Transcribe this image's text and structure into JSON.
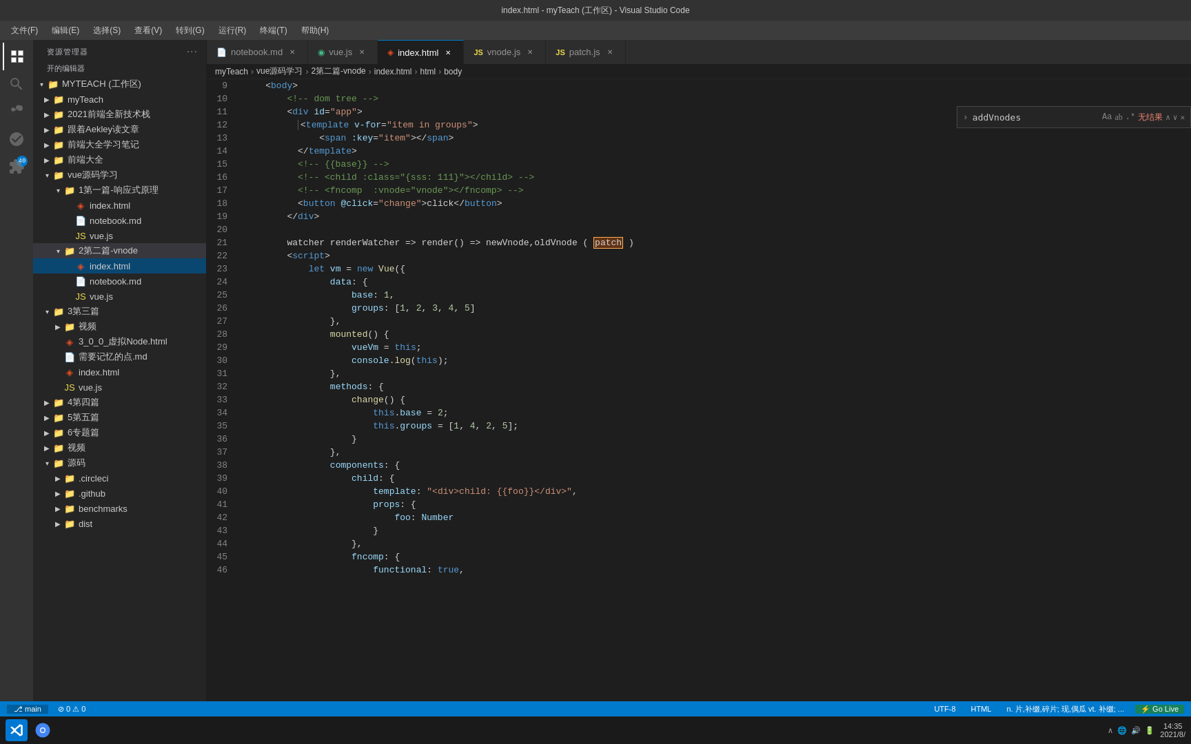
{
  "titleBar": {
    "text": "index.html - myTeach (工作区) - Visual Studio Code"
  },
  "menuBar": {
    "items": [
      "文件(F)",
      "编辑(E)",
      "选择(S)",
      "查看(V)",
      "转到(G)",
      "运行(R)",
      "终端(T)",
      "帮助(H)"
    ]
  },
  "sidebar": {
    "explorerTitle": "资源管理器",
    "openEditorTitle": "开的编辑器",
    "dots": "···",
    "tree": {
      "rootLabel": "MYTEACH (工作区)",
      "items": [
        {
          "id": "myTeach",
          "label": "myTeach",
          "type": "folder",
          "depth": 0,
          "expanded": false
        },
        {
          "id": "2021新技术栈",
          "label": "2021前端全新技术栈",
          "type": "folder",
          "depth": 0,
          "expanded": false
        },
        {
          "id": "Aekley笔记",
          "label": "跟着Aekley读文章",
          "type": "folder",
          "depth": 0,
          "expanded": false
        },
        {
          "id": "前端大学",
          "label": "前端大全学习笔记",
          "type": "folder",
          "depth": 0,
          "expanded": false
        },
        {
          "id": "前端大全",
          "label": "前端大全",
          "type": "folder",
          "depth": 0,
          "expanded": false
        },
        {
          "id": "vue源码学习",
          "label": "vue源码学习",
          "type": "folder",
          "depth": 0,
          "expanded": true
        },
        {
          "id": "1第一篇",
          "label": "1第一篇-响应式原理",
          "type": "folder",
          "depth": 1,
          "expanded": true
        },
        {
          "id": "index.html-1",
          "label": "index.html",
          "type": "html",
          "depth": 2,
          "expanded": false
        },
        {
          "id": "notebook.md-1",
          "label": "notebook.md",
          "type": "md",
          "depth": 2,
          "expanded": false
        },
        {
          "id": "vue.js-1",
          "label": "vue.js",
          "type": "js",
          "depth": 2,
          "expanded": false
        },
        {
          "id": "2第二篇-vnode",
          "label": "2第二篇-vnode",
          "type": "folder",
          "depth": 1,
          "expanded": true,
          "active": true
        },
        {
          "id": "index.html-2",
          "label": "index.html",
          "type": "html",
          "depth": 2,
          "expanded": false,
          "active": true
        },
        {
          "id": "notebook.md-2",
          "label": "notebook.md",
          "type": "md",
          "depth": 2,
          "expanded": false
        },
        {
          "id": "vue.js-2",
          "label": "vue.js",
          "type": "js",
          "depth": 2,
          "expanded": false
        },
        {
          "id": "3第三篇",
          "label": "3第三篇",
          "type": "folder",
          "depth": 0,
          "expanded": false
        },
        {
          "id": "视频1",
          "label": "视频",
          "type": "folder",
          "depth": 1,
          "expanded": false
        },
        {
          "id": "3_0_0",
          "label": "3_0_0_虚拟Node.html",
          "type": "html",
          "depth": 1,
          "expanded": false
        },
        {
          "id": "需要记忆",
          "label": "需要记忆的点.md",
          "type": "md",
          "depth": 1,
          "expanded": false
        },
        {
          "id": "index.html-3",
          "label": "index.html",
          "type": "html",
          "depth": 1,
          "expanded": false
        },
        {
          "id": "vue.js-3",
          "label": "vue.js",
          "type": "js",
          "depth": 1,
          "expanded": false
        },
        {
          "id": "4第四篇",
          "label": "4第四篇",
          "type": "folder",
          "depth": 0,
          "expanded": false
        },
        {
          "id": "5第五篇",
          "label": "5第五篇",
          "type": "folder",
          "depth": 0,
          "expanded": false
        },
        {
          "id": "6专题篇",
          "label": "6专题篇",
          "type": "folder",
          "depth": 0,
          "expanded": false
        },
        {
          "id": "视频2",
          "label": "视频",
          "type": "folder",
          "depth": 0,
          "expanded": false
        },
        {
          "id": "源码",
          "label": "源码",
          "type": "folder",
          "depth": 0,
          "expanded": true
        },
        {
          "id": "circleci",
          "label": ".circleci",
          "type": "folder",
          "depth": 1,
          "expanded": false
        },
        {
          "id": "github",
          "label": ".github",
          "type": "folder",
          "depth": 1,
          "expanded": false
        },
        {
          "id": "benchmarks",
          "label": "benchmarks",
          "type": "folder",
          "depth": 1,
          "expanded": false
        },
        {
          "id": "dist",
          "label": "dist",
          "type": "folder",
          "depth": 1,
          "expanded": false
        }
      ]
    }
  },
  "tabs": [
    {
      "id": "notebook",
      "label": "notebook.md",
      "icon": "md",
      "active": false,
      "closable": true
    },
    {
      "id": "vue",
      "label": "vue.js",
      "icon": "js",
      "active": false,
      "closable": true
    },
    {
      "id": "index",
      "label": "index.html",
      "icon": "html",
      "active": true,
      "closable": true
    },
    {
      "id": "vnode",
      "label": "vnode.js",
      "icon": "js",
      "active": false,
      "closable": true
    },
    {
      "id": "patch",
      "label": "patch.js",
      "icon": "js",
      "active": false,
      "closable": true
    }
  ],
  "breadcrumb": {
    "items": [
      "myTeach",
      "vue源码学习",
      "2第二篇-vnode",
      "index.html",
      "html",
      "body"
    ]
  },
  "searchBar": {
    "value": "addVnodes",
    "noResults": "无结果"
  },
  "codeLines": [
    {
      "num": 9,
      "content": "    <body>"
    },
    {
      "num": 10,
      "content": "        <!-- dom tree -->"
    },
    {
      "num": 11,
      "content": "        <div id=\"app\">"
    },
    {
      "num": 12,
      "content": "          <template v-for=\"item in groups\">"
    },
    {
      "num": 13,
      "content": "              <span :key=\"item\"></span>"
    },
    {
      "num": 14,
      "content": "          </template>"
    },
    {
      "num": 15,
      "content": "          <!-- {{base}} -->"
    },
    {
      "num": 16,
      "content": "          <!-- <child :class=\"{sss: 111}\"></child> -->"
    },
    {
      "num": 17,
      "content": "          <!-- <fncomp  :vnode=\"vnode\"></fncomp> -->"
    },
    {
      "num": 18,
      "content": "          <button @click=\"change\">click</button>"
    },
    {
      "num": 19,
      "content": "        </div>"
    },
    {
      "num": 20,
      "content": ""
    },
    {
      "num": 21,
      "content": "        watcher renderWatcher => render() => newVnode,oldVnode ( patch )"
    },
    {
      "num": 22,
      "content": "        <script>"
    },
    {
      "num": 23,
      "content": "            let vm = new Vue({"
    },
    {
      "num": 24,
      "content": "                data: {"
    },
    {
      "num": 25,
      "content": "                    base: 1,"
    },
    {
      "num": 26,
      "content": "                    groups: [1, 2, 3, 4, 5]"
    },
    {
      "num": 27,
      "content": "                },"
    },
    {
      "num": 28,
      "content": "                mounted() {"
    },
    {
      "num": 29,
      "content": "                    vueVm = this;"
    },
    {
      "num": 30,
      "content": "                    console.log(this);"
    },
    {
      "num": 31,
      "content": "                },"
    },
    {
      "num": 32,
      "content": "                methods: {"
    },
    {
      "num": 33,
      "content": "                    change() {"
    },
    {
      "num": 34,
      "content": "                        this.base = 2;"
    },
    {
      "num": 35,
      "content": "                        this.groups = [1, 4, 2, 5];"
    },
    {
      "num": 36,
      "content": "                    }"
    },
    {
      "num": 37,
      "content": "                },"
    },
    {
      "num": 38,
      "content": "                components: {"
    },
    {
      "num": 39,
      "content": "                    child: {"
    },
    {
      "num": 40,
      "content": "                        template: \"<div>child: {{foo}}</div>\","
    },
    {
      "num": 41,
      "content": "                        props: {"
    },
    {
      "num": 42,
      "content": "                            foo: Number"
    },
    {
      "num": 43,
      "content": "                        }"
    },
    {
      "num": 44,
      "content": "                    },"
    },
    {
      "num": 45,
      "content": "                    fncomp: {"
    },
    {
      "num": 46,
      "content": "                        functional: true,"
    }
  ],
  "statusBar": {
    "left": [
      {
        "icon": "⎇",
        "text": "Go Live"
      },
      {
        "text": "main"
      }
    ],
    "encoding": "UTF-8",
    "language": "HTML",
    "info": "n. 片,补缀,碎片; 现,偶瓜 vt. 补缀; ...",
    "goLive": "Go Live",
    "time": "14:35",
    "date": "2021/8/"
  },
  "taskbar": {
    "time": "14:35",
    "date": "2021/8/"
  },
  "colors": {
    "vscodeBlue": "#007acc",
    "sidebar": "#252526",
    "editor": "#1e1e1e",
    "tabBar": "#2d2d2d",
    "activeTab": "#1e1e1e",
    "statusBar": "#007acc"
  }
}
